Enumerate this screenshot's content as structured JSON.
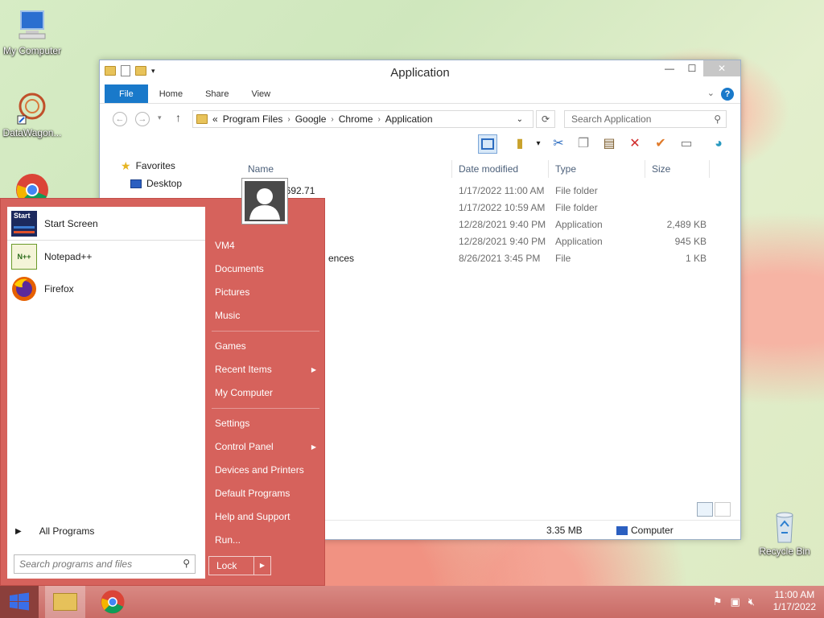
{
  "desktop": {
    "icons": [
      {
        "label": "My Computer"
      },
      {
        "label": "DataWagon..."
      },
      {
        "label": "Recycle Bin"
      }
    ]
  },
  "window": {
    "title": "Application",
    "ribbon_tabs": [
      "File",
      "Home",
      "Share",
      "View"
    ],
    "help": "?",
    "address": {
      "prefix": "«",
      "crumbs": [
        "Program Files",
        "Google",
        "Chrome",
        "Application"
      ]
    },
    "search_placeholder": "Search Application",
    "nav": {
      "favorites": "Favorites",
      "desktop": "Desktop"
    },
    "columns": [
      "Name",
      "Date modified",
      "Type",
      "Size"
    ],
    "rows": [
      {
        "name": "3692.71",
        "date": "1/17/2022 11:00 AM",
        "type": "File folder",
        "size": ""
      },
      {
        "name": "",
        "date": "1/17/2022 10:59 AM",
        "type": "File folder",
        "size": ""
      },
      {
        "name": "",
        "date": "12/28/2021 9:40 PM",
        "type": "Application",
        "size": "2,489 KB"
      },
      {
        "name": "",
        "date": "12/28/2021 9:40 PM",
        "type": "Application",
        "size": "945 KB"
      },
      {
        "name": "ences",
        "date": "8/26/2021 3:45 PM",
        "type": "File",
        "size": "1 KB"
      }
    ],
    "status": {
      "size": "3.35 MB",
      "location": "Computer"
    }
  },
  "start_menu": {
    "programs": [
      "Start Screen",
      "Notepad++",
      "Firefox"
    ],
    "all_programs": "All Programs",
    "search_placeholder": "Search programs and files",
    "right_items_1": [
      "VM4",
      "Documents",
      "Pictures",
      "Music"
    ],
    "right_items_2": [
      "Games",
      "Recent Items",
      "My Computer"
    ],
    "right_items_3": [
      "Settings",
      "Control Panel",
      "Devices and Printers",
      "Default Programs",
      "Help and Support",
      "Run..."
    ],
    "lock": "Lock",
    "start_screen_icon_text": "Start"
  },
  "taskbar": {
    "time": "11:00 AM",
    "date": "1/17/2022"
  }
}
